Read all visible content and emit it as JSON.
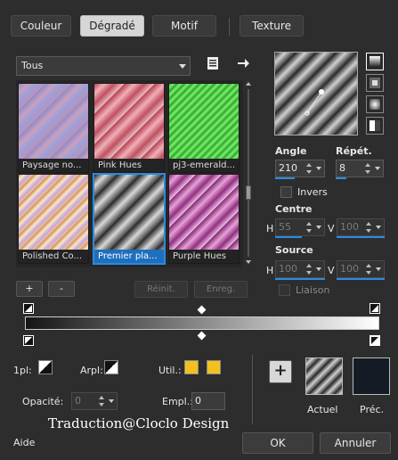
{
  "tabs": [
    {
      "label": "Couleur"
    },
    {
      "label": "Dégradé"
    },
    {
      "label": "Motif"
    },
    {
      "label": "Texture"
    }
  ],
  "library": {
    "dropdown_value": "Tous",
    "thumbnails": [
      {
        "caption": "Paysage no..."
      },
      {
        "caption": "Pink Hues"
      },
      {
        "caption": "pj3-emerald..."
      },
      {
        "caption": "Polished Co..."
      },
      {
        "caption": "Premier pla..."
      },
      {
        "caption": "Purple Hues"
      }
    ],
    "add_label": "+",
    "remove_label": "-",
    "reset_label": "Réinit.",
    "save_label": "Enreg."
  },
  "gradient_settings": {
    "angle_label": "Angle",
    "angle_value": "210",
    "repeat_label": "Répét.",
    "repeat_value": "8",
    "invert_label": "Invers",
    "center_label": "Centre",
    "center_h_label": "H",
    "center_h_value": "55",
    "center_v_label": "V",
    "center_v_value": "100",
    "source_label": "Source",
    "source_h_label": "H",
    "source_h_value": "100",
    "source_v_label": "V",
    "source_v_value": "100",
    "link_label": "Liaison"
  },
  "stop_settings": {
    "first_label": "1pl:",
    "arpl_label": "Arpl:",
    "util_label": "Util.:",
    "opacity_label": "Opacité:",
    "opacity_value": "0",
    "empl_label": "Empl.:",
    "empl_value": "0",
    "color_yellow": "#f4c020"
  },
  "preview": {
    "current_label": "Actuel",
    "previous_label": "Préc.",
    "add_label": "+"
  },
  "watermark": "Traduction@Cloclo Design",
  "footer": {
    "help_label": "Aide",
    "ok_label": "OK",
    "cancel_label": "Annuler"
  }
}
